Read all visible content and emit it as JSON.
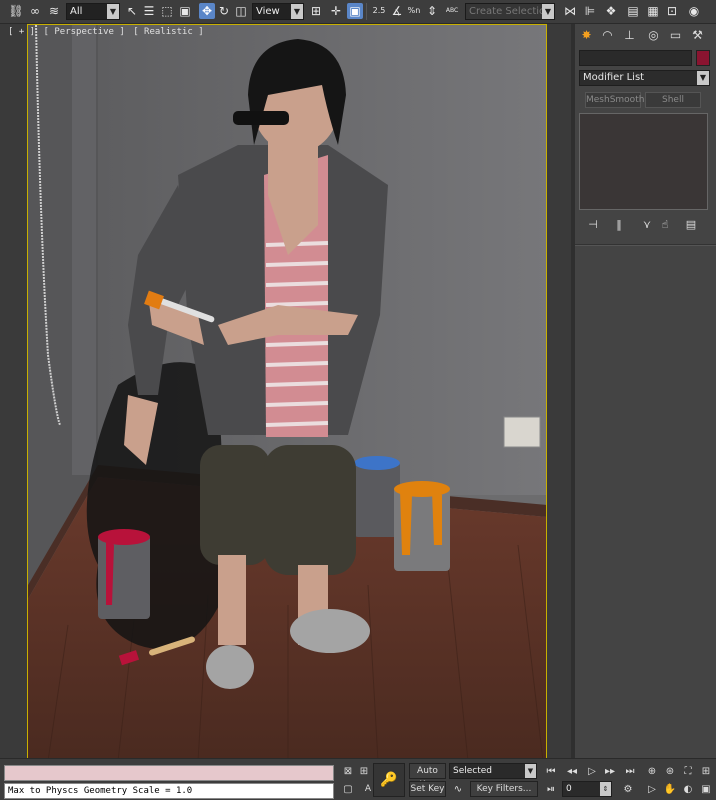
{
  "toolbar": {
    "selection_filter": "All",
    "reference_coord": "View",
    "named_selection_placeholder": "Create Selection Se",
    "snaps_2_5": "2.5",
    "percent_snap": "%n",
    "abc_icon": "ABC"
  },
  "viewport": {
    "plus": "[ + ]",
    "view": "[ Perspective ]",
    "shading": "[ Realistic ]"
  },
  "command_panel": {
    "modifier_list": "Modifier List",
    "buttons": [
      "MeshSmooth",
      "Shell"
    ],
    "object_color": "#8a1430"
  },
  "bottom": {
    "maxscript_output": "Max to Physcs Geometry Scale = 1.0",
    "auto_key": "Auto Key",
    "set_key": "Set Key",
    "key_mode": "Selected",
    "key_filters": "Key Filters...",
    "frame": "0",
    "small_a": "A"
  }
}
